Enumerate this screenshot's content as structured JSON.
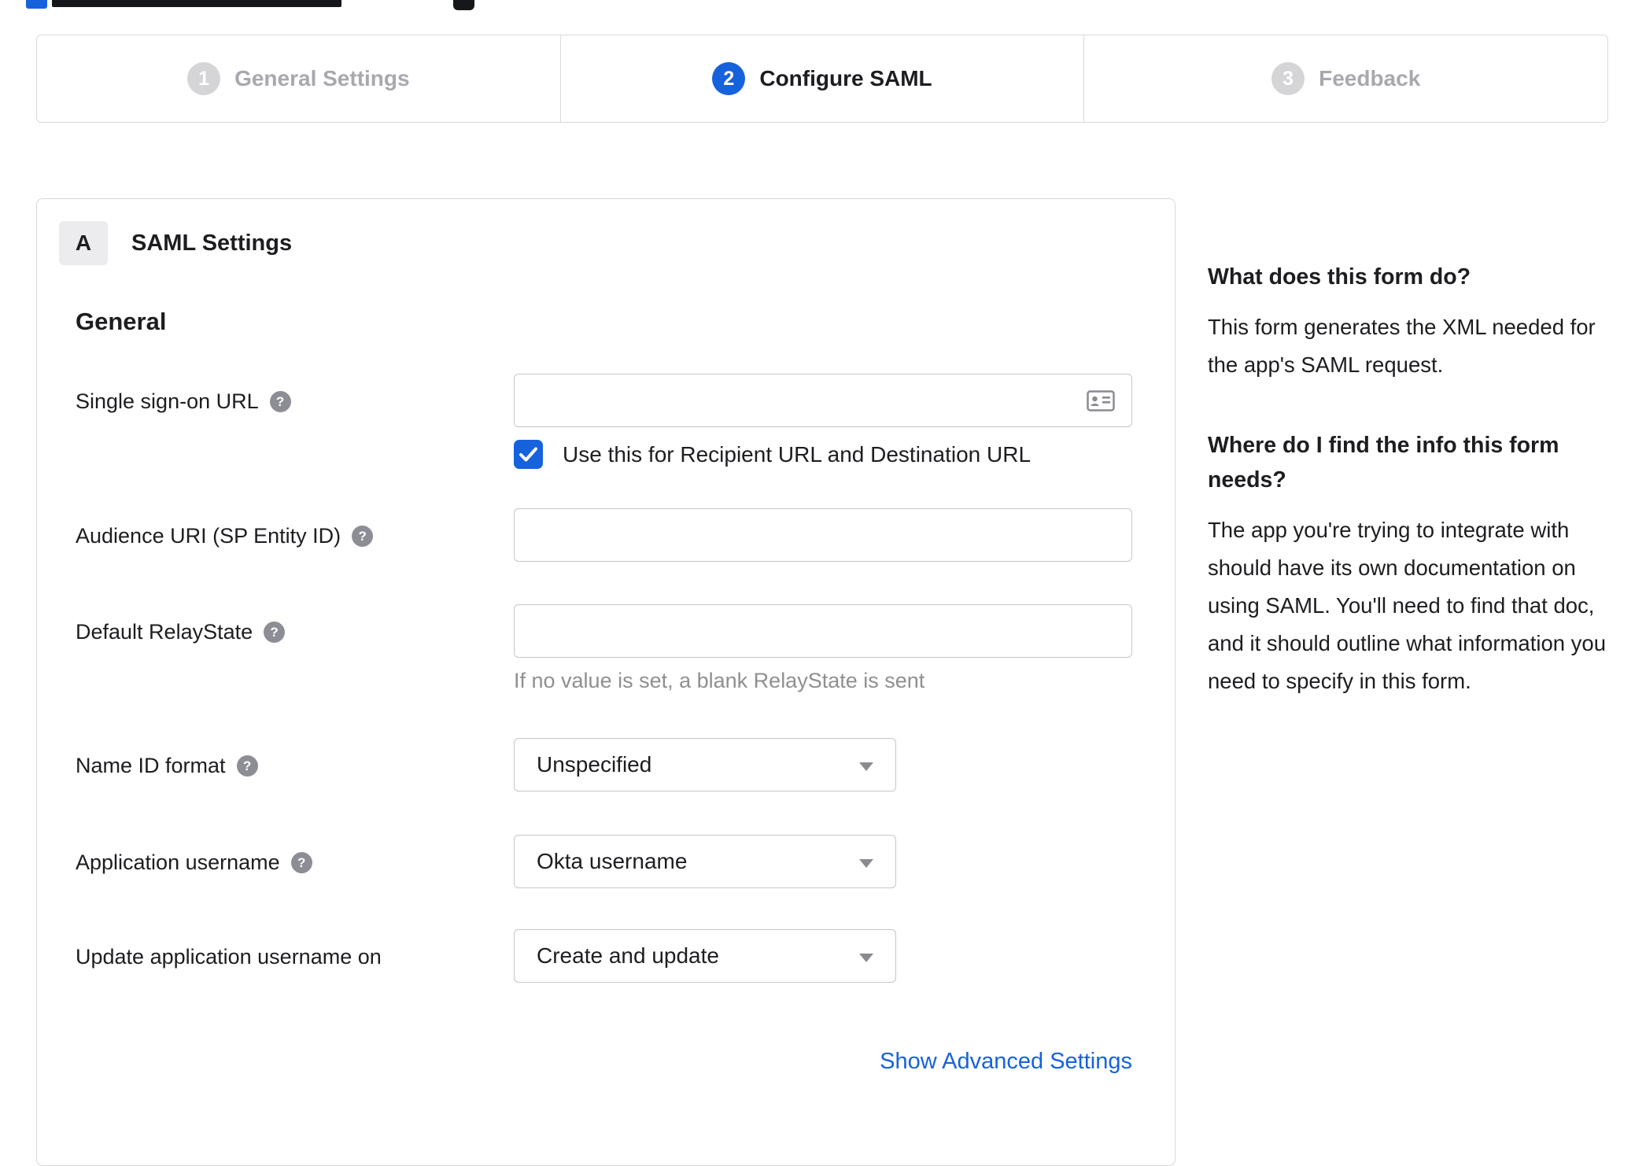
{
  "colors": {
    "accent_blue": "#1662dd",
    "link_blue": "#1662dd",
    "inactive_gray": "#a8a8ae"
  },
  "icons": {
    "help": "?"
  },
  "stepper": {
    "steps": [
      {
        "number": "1",
        "label": "General Settings",
        "state": "inactive"
      },
      {
        "number": "2",
        "label": "Configure SAML",
        "state": "active"
      },
      {
        "number": "3",
        "label": "Feedback",
        "state": "inactive"
      }
    ]
  },
  "panel": {
    "section_badge": "A",
    "section_title": "SAML Settings",
    "group_title": "General",
    "fields": {
      "sso_url": {
        "label": "Single sign-on URL",
        "value": ""
      },
      "sso_checkbox": {
        "label": "Use this for Recipient URL and Destination URL",
        "checked": true
      },
      "audience_uri": {
        "label": "Audience URI (SP Entity ID)",
        "value": ""
      },
      "relay_state": {
        "label": "Default RelayState",
        "value": "",
        "hint": "If no value is set, a blank RelayState is sent"
      },
      "name_id_format": {
        "label": "Name ID format",
        "value": "Unspecified"
      },
      "app_username": {
        "label": "Application username",
        "value": "Okta username"
      },
      "update_username": {
        "label": "Update application username on",
        "value": "Create and update"
      }
    },
    "advanced_link": "Show Advanced Settings"
  },
  "sidebar": {
    "sections": [
      {
        "title": "What does this form do?",
        "body": "This form generates the XML needed for the app's SAML request."
      },
      {
        "title": "Where do I find the info this form needs?",
        "body": "The app you're trying to integrate with should have its own documentation on using SAML. You'll need to find that doc, and it should outline what information you need to specify in this form."
      }
    ]
  }
}
